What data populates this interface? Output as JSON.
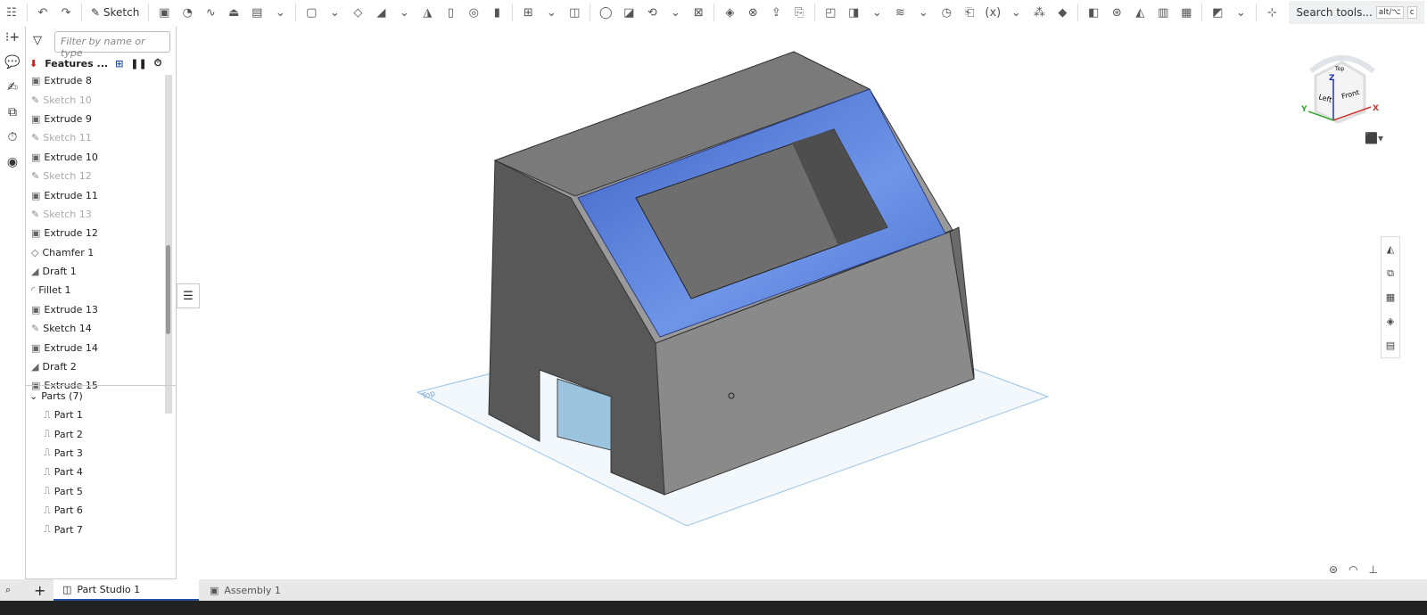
{
  "toolbar": {
    "sketch_label": "Sketch",
    "search_label": "Search tools...",
    "search_shortcut": "alt/⌥",
    "search_key": "c"
  },
  "feature_panel": {
    "filter_placeholder": "Filter by name or type",
    "header": "Features ...",
    "features": [
      {
        "name": "Extrude 8",
        "type": "extrude",
        "suppressed": false
      },
      {
        "name": "Sketch 10",
        "type": "sketch",
        "suppressed": true
      },
      {
        "name": "Extrude 9",
        "type": "extrude",
        "suppressed": false
      },
      {
        "name": "Sketch 11",
        "type": "sketch",
        "suppressed": true
      },
      {
        "name": "Extrude 10",
        "type": "extrude",
        "suppressed": false
      },
      {
        "name": "Sketch 12",
        "type": "sketch",
        "suppressed": true
      },
      {
        "name": "Extrude 11",
        "type": "extrude",
        "suppressed": false
      },
      {
        "name": "Sketch 13",
        "type": "sketch",
        "suppressed": true
      },
      {
        "name": "Extrude 12",
        "type": "extrude",
        "suppressed": false
      },
      {
        "name": "Chamfer 1",
        "type": "chamfer",
        "suppressed": false
      },
      {
        "name": "Draft 1",
        "type": "draft",
        "suppressed": false
      },
      {
        "name": "Fillet 1",
        "type": "fillet",
        "suppressed": false
      },
      {
        "name": "Extrude 13",
        "type": "extrude",
        "suppressed": false
      },
      {
        "name": "Sketch 14",
        "type": "sketch",
        "suppressed": false
      },
      {
        "name": "Extrude 14",
        "type": "extrude",
        "suppressed": false
      },
      {
        "name": "Draft 2",
        "type": "draft",
        "suppressed": false
      },
      {
        "name": "Extrude 15",
        "type": "extrude",
        "suppressed": false
      }
    ],
    "parts_header": "Parts (7)",
    "parts": [
      "Part 1",
      "Part 2",
      "Part 3",
      "Part 4",
      "Part 5",
      "Part 6",
      "Part 7"
    ]
  },
  "viewcube": {
    "top": "Top",
    "left": "Left",
    "front": "Front",
    "x": "X",
    "y": "Y",
    "z": "Z"
  },
  "viewport": {
    "plane_label": "Top",
    "selection_color": "#4f79d6"
  },
  "tabs": [
    {
      "label": "Part Studio 1",
      "active": true
    },
    {
      "label": "Assembly 1",
      "active": false
    }
  ]
}
